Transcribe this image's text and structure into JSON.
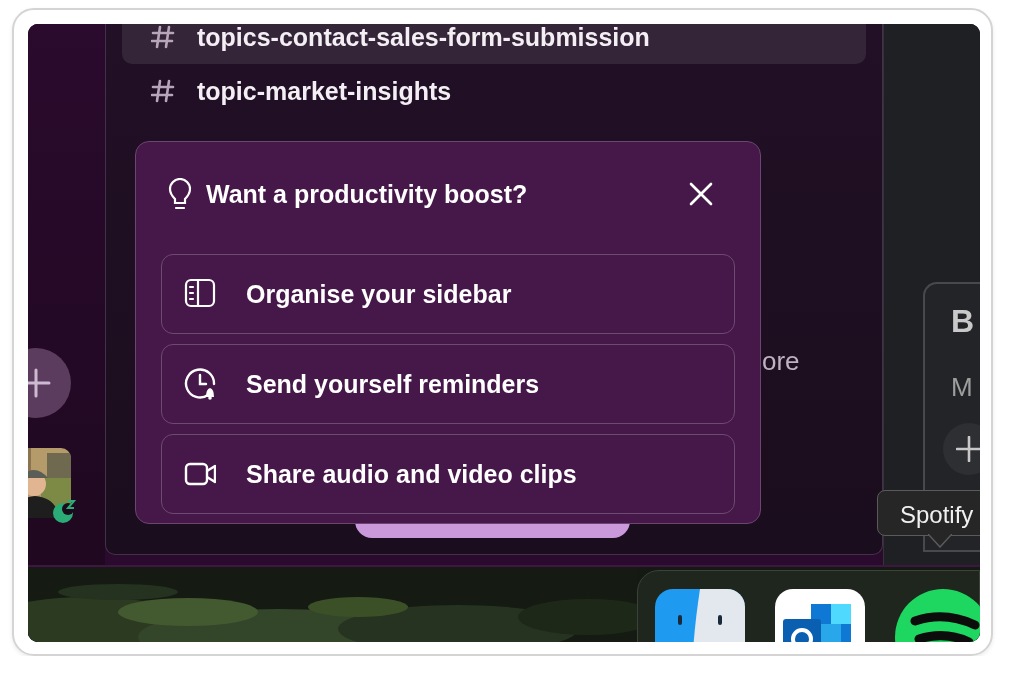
{
  "sidebar": {
    "channels": [
      {
        "name": "topics-contact-sales-form-submission",
        "selected": true
      },
      {
        "name": "topic-market-insights",
        "selected": false
      }
    ],
    "partial_item": "ore"
  },
  "popup": {
    "title": "Want a productivity boost?",
    "options": [
      {
        "kind": "sidebar",
        "label": "Organise your sidebar"
      },
      {
        "kind": "reminder",
        "label": "Send yourself reminders"
      },
      {
        "kind": "clip",
        "label": "Share audio and video clips"
      }
    ]
  },
  "side_panel": {
    "heading": "B",
    "subtext": "M"
  },
  "tooltip": "Spotify",
  "dock": {
    "apps": [
      {
        "kind": "finder"
      },
      {
        "kind": "outlook"
      },
      {
        "kind": "spotify"
      }
    ]
  }
}
